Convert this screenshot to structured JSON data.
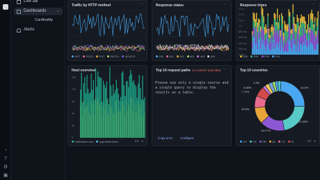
{
  "sidebar": {
    "items": [
      {
        "label": "Live tail"
      },
      {
        "label": "Dashboards"
      },
      {
        "label": "Cardinality"
      },
      {
        "label": "Alerts"
      }
    ]
  },
  "panels": {
    "traffic": {
      "title": "Traffic by HTTP method",
      "legend": [
        "GET",
        "POST",
        "PUT",
        "PATCH",
        "DELETE"
      ],
      "colors": [
        "#4aa7f0",
        "#e96a8d",
        "#e8a53a",
        "#a3d86b",
        "#6f5de0"
      ]
    },
    "status": {
      "title": "Response status",
      "legend": [
        "200",
        "301",
        "302",
        "401",
        "404",
        "500"
      ],
      "colors": [
        "#4aa7f0",
        "#e96a8d",
        "#e8a53a",
        "#a3d86b",
        "#c479e6",
        "#d7d9dc"
      ]
    },
    "times": {
      "title": "Response times",
      "legend": [
        "P50",
        "P90",
        "P95",
        "P99"
      ],
      "colors": [
        "#e8b93a",
        "#39b27a",
        "#8e57d6",
        "#4aa7f0"
      ],
      "yticks": [
        "1.6 s",
        "1.4 s",
        "1.2 s",
        "1 s",
        "800 ms",
        "600 ms",
        "400 ms",
        "200 ms",
        "0 ms"
      ]
    },
    "host": {
      "title": "Host overview",
      "legend": [
        "betterstack.com",
        "logs.betterstack..."
      ],
      "page": "1/3",
      "colors": [
        "#39b27a",
        "#5db4f0"
      ],
      "yticks": [
        "15K",
        "12K",
        "9K",
        "6K",
        "3K",
        "0"
      ]
    },
    "paths": {
      "title": "Top 10 request paths",
      "error": "Couldn't load data",
      "message": "Please use only a single source and a single query to display the results as a table.",
      "copy_error": "Copy error",
      "configure": "Configure"
    },
    "countries": {
      "title": "Top 10 countries",
      "legend": [
        "US",
        "CA",
        "GB",
        "AU",
        "CZ",
        "IN"
      ],
      "page": "1/2",
      "labels": {
        "a": "24.5%",
        "b": "21.66%",
        "c": "16.17%",
        "d": "10.8%",
        "e": "7.72%",
        "f": "6.65%",
        "g": "1.9%"
      }
    }
  },
  "chart_data": [
    {
      "type": "pie",
      "title": "Top 10 countries",
      "slices": [
        {
          "name": "US",
          "value": 24.5
        },
        {
          "name": "CA",
          "value": 21.66
        },
        {
          "name": "GB",
          "value": 16.17
        },
        {
          "name": "AU",
          "value": 10.8
        },
        {
          "name": "CZ",
          "value": 7.72
        },
        {
          "name": "IN",
          "value": 6.65
        },
        {
          "name": "",
          "value": 1.9
        }
      ],
      "colors": [
        "#4aa7f0",
        "#57c9c6",
        "#8e57d6",
        "#e8a53a",
        "#e96a8d",
        "#d44a4a",
        "#c479e6",
        "#f0c85a",
        "#6fa8dc",
        "#a3d86b"
      ]
    }
  ]
}
